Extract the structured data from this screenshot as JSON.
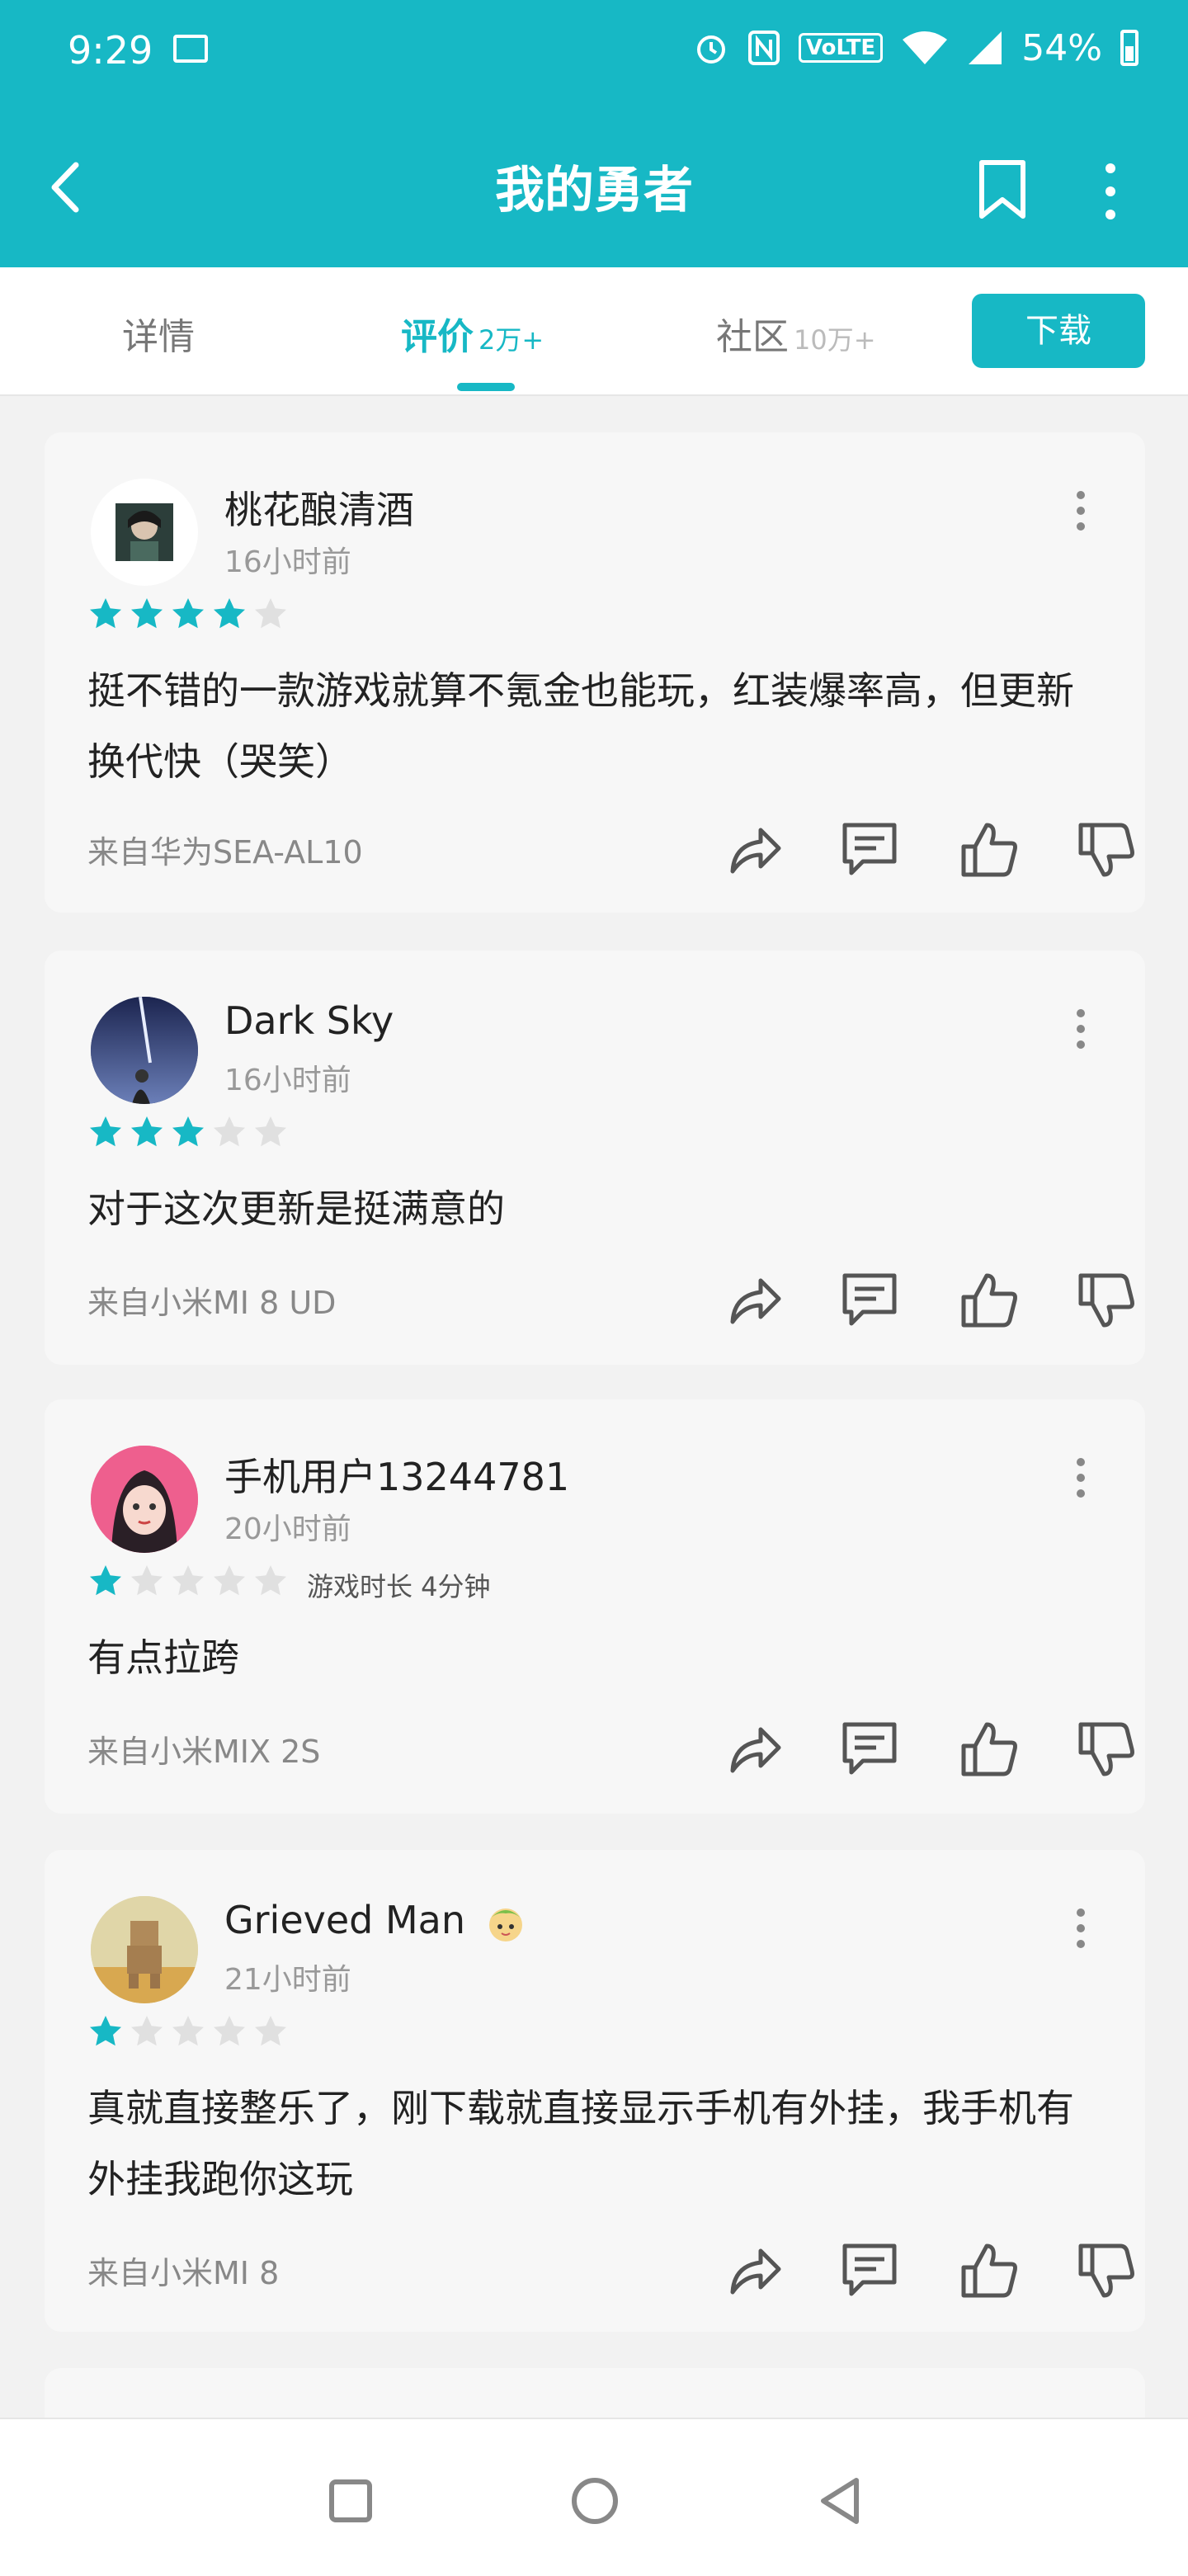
{
  "status": {
    "time": "9:29",
    "volte": "VoLTE",
    "battery": "54%"
  },
  "appbar": {
    "title": "我的勇者"
  },
  "tabs": [
    {
      "label": "详情",
      "count": ""
    },
    {
      "label": "评价",
      "count": "2万+"
    },
    {
      "label": "社区",
      "count": "10万+"
    }
  ],
  "download_label": "下载",
  "colors": {
    "accent": "#17b8c5",
    "star_empty": "#e0e0e0"
  },
  "reviews": [
    {
      "user": "桃花酿清酒",
      "time": "16小时前",
      "rating": 4,
      "play_time": "",
      "text": "挺不错的一款游戏就算不氪金也能玩，红装爆率高，但更新换代快（哭笑）",
      "device": "来自华为SEA-AL10"
    },
    {
      "user": "Dark Sky",
      "time": "16小时前",
      "rating": 3,
      "play_time": "",
      "text": "对于这次更新是挺满意的",
      "device": "来自小米MI 8 UD"
    },
    {
      "user": "手机用户13244781",
      "time": "20小时前",
      "rating": 1,
      "play_time": "游戏时长 4分钟",
      "text": "有点拉跨",
      "device": "来自小米MIX 2S"
    },
    {
      "user": "Grieved Man",
      "time": "21小时前",
      "rating": 1,
      "play_time": "",
      "text": "真就直接整乐了，刚下载就直接显示手机有外挂，我手机有外挂我跑你这玩",
      "device": "来自小米MI 8"
    }
  ]
}
